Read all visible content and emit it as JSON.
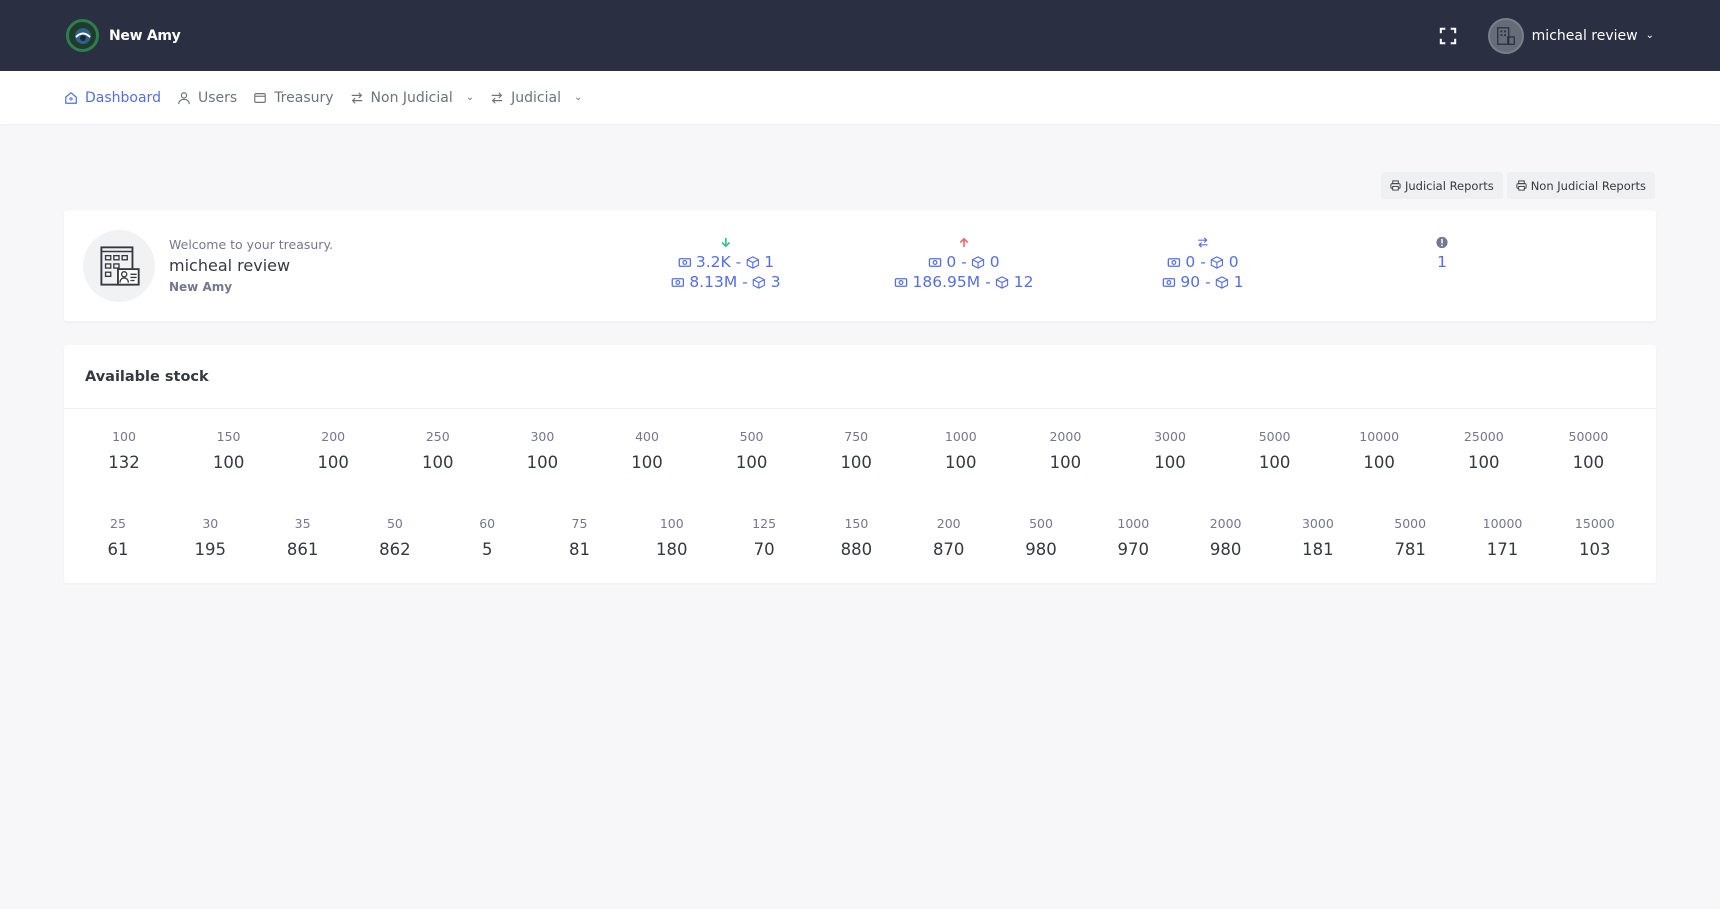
{
  "topbar": {
    "brand_name": "New Amy",
    "user_name": "micheal review"
  },
  "nav": {
    "items": [
      {
        "label": "Dashboard",
        "icon": "home-icon",
        "active": true
      },
      {
        "label": "Users",
        "icon": "user-icon"
      },
      {
        "label": "Treasury",
        "icon": "wallet-icon"
      },
      {
        "label": "Non Judicial",
        "icon": "transfer-icon",
        "dropdown": true
      },
      {
        "label": "Judicial",
        "icon": "transfer-icon",
        "dropdown": true
      }
    ]
  },
  "reports": {
    "judicial_label": "Judicial Reports",
    "non_judicial_label": "Non Judicial Reports"
  },
  "welcome": {
    "line": "Welcome to your treasury.",
    "user_name": "micheal review",
    "org_name": "New Amy"
  },
  "stats": [
    {
      "arrow": "arrow-down-icon",
      "arrow_color": "#34c38f",
      "line1": [
        "3.2K",
        "1"
      ],
      "line2": [
        "8.13M",
        "3"
      ]
    },
    {
      "arrow": "arrow-up-icon",
      "arrow_color": "#f46a6a",
      "line1": [
        "0",
        "0"
      ],
      "line2": [
        "186.95M",
        "12"
      ]
    },
    {
      "arrow": "transfer-icon",
      "arrow_color": "#556ee6",
      "line1": [
        "0",
        "0"
      ],
      "line2": [
        "90",
        "1"
      ]
    },
    {
      "arrow": "info-icon",
      "arrow_color": "#74788d",
      "value": "1"
    }
  ],
  "stock": {
    "title": "Available stock",
    "row1": [
      {
        "denom": "100",
        "qty": "132"
      },
      {
        "denom": "150",
        "qty": "100"
      },
      {
        "denom": "200",
        "qty": "100"
      },
      {
        "denom": "250",
        "qty": "100"
      },
      {
        "denom": "300",
        "qty": "100"
      },
      {
        "denom": "400",
        "qty": "100"
      },
      {
        "denom": "500",
        "qty": "100"
      },
      {
        "denom": "750",
        "qty": "100"
      },
      {
        "denom": "1000",
        "qty": "100"
      },
      {
        "denom": "2000",
        "qty": "100"
      },
      {
        "denom": "3000",
        "qty": "100"
      },
      {
        "denom": "5000",
        "qty": "100"
      },
      {
        "denom": "10000",
        "qty": "100"
      },
      {
        "denom": "25000",
        "qty": "100"
      },
      {
        "denom": "50000",
        "qty": "100"
      }
    ],
    "row2": [
      {
        "denom": "25",
        "qty": "61"
      },
      {
        "denom": "30",
        "qty": "195"
      },
      {
        "denom": "35",
        "qty": "861"
      },
      {
        "denom": "50",
        "qty": "862"
      },
      {
        "denom": "60",
        "qty": "5"
      },
      {
        "denom": "75",
        "qty": "81"
      },
      {
        "denom": "100",
        "qty": "180"
      },
      {
        "denom": "125",
        "qty": "70"
      },
      {
        "denom": "150",
        "qty": "880"
      },
      {
        "denom": "200",
        "qty": "870"
      },
      {
        "denom": "500",
        "qty": "980"
      },
      {
        "denom": "1000",
        "qty": "970"
      },
      {
        "denom": "2000",
        "qty": "980"
      },
      {
        "denom": "3000",
        "qty": "181"
      },
      {
        "denom": "5000",
        "qty": "781"
      },
      {
        "denom": "10000",
        "qty": "171"
      },
      {
        "denom": "15000",
        "qty": "103"
      }
    ]
  },
  "colors": {
    "topbar": "#2a3042",
    "accent": "#556ee6",
    "in": "#34c38f",
    "out": "#f46a6a"
  }
}
